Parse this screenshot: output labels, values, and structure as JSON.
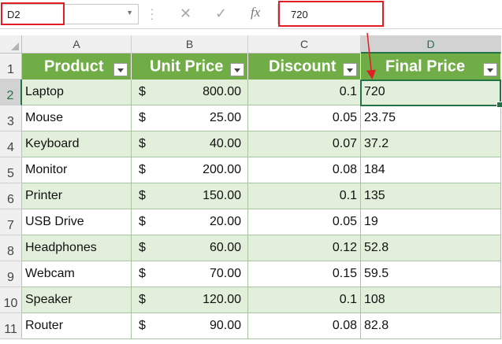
{
  "formula_bar": {
    "name_box": "D2",
    "cancel_icon": "✕",
    "enter_icon": "✓",
    "fx_label": "fx",
    "formula_value": "720"
  },
  "columns": [
    "A",
    "B",
    "C",
    "D"
  ],
  "selected_column": "D",
  "selected_row": 2,
  "row_numbers": [
    "1",
    "2",
    "3",
    "4",
    "5",
    "6",
    "7",
    "8",
    "9",
    "10",
    "11"
  ],
  "headers": [
    "Product",
    "Unit Price",
    "Discount",
    "Final Price"
  ],
  "currency_symbol": "$",
  "rows": [
    {
      "product": "Laptop",
      "unit_price": "800.00",
      "discount": "0.1",
      "final_price": "720"
    },
    {
      "product": "Mouse",
      "unit_price": "25.00",
      "discount": "0.05",
      "final_price": "23.75"
    },
    {
      "product": "Keyboard",
      "unit_price": "40.00",
      "discount": "0.07",
      "final_price": "37.2"
    },
    {
      "product": "Monitor",
      "unit_price": "200.00",
      "discount": "0.08",
      "final_price": "184"
    },
    {
      "product": "Printer",
      "unit_price": "150.00",
      "discount": "0.1",
      "final_price": "135"
    },
    {
      "product": "USB Drive",
      "unit_price": "20.00",
      "discount": "0.05",
      "final_price": "19"
    },
    {
      "product": "Headphones",
      "unit_price": "60.00",
      "discount": "0.12",
      "final_price": "52.8"
    },
    {
      "product": "Webcam",
      "unit_price": "70.00",
      "discount": "0.15",
      "final_price": "59.5"
    },
    {
      "product": "Speaker",
      "unit_price": "120.00",
      "discount": "0.1",
      "final_price": "108"
    },
    {
      "product": "Router",
      "unit_price": "90.00",
      "discount": "0.08",
      "final_price": "82.8"
    }
  ],
  "colors": {
    "header_fill": "#70ad47",
    "band_fill": "#e2efda",
    "selection": "#217346",
    "callout": "#e01e24"
  }
}
